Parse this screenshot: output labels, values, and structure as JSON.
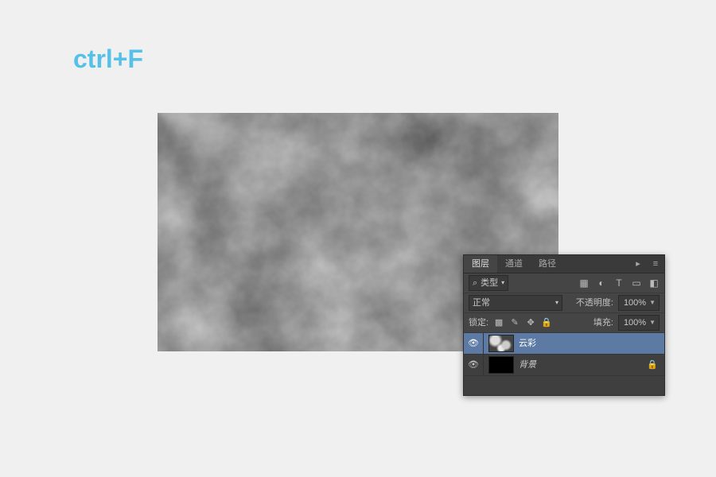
{
  "shortcut_text": "ctrl+F",
  "panel": {
    "tabs": {
      "layers": "图层",
      "channels": "通道",
      "paths": "路径"
    },
    "filter": {
      "label": "类型"
    },
    "blend": {
      "mode": "正常",
      "opacity_label": "不透明度:",
      "opacity_value": "100%"
    },
    "lock": {
      "label": "锁定:",
      "fill_label": "填充:",
      "fill_value": "100%"
    },
    "layers": [
      {
        "name": "云彩",
        "selected": true,
        "thumb": "clouds",
        "locked": false
      },
      {
        "name": "背景",
        "selected": false,
        "thumb": "black",
        "locked": true
      }
    ]
  }
}
